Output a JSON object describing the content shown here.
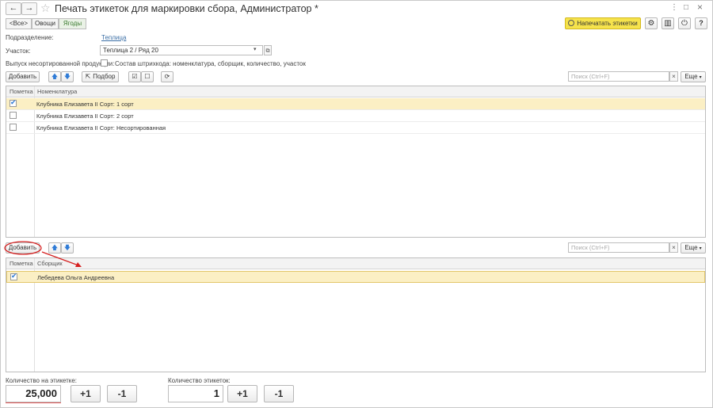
{
  "window": {
    "title": "Печать этикеток для маркировки сбора, Администратор *",
    "nav_back": "←",
    "nav_forward": "→",
    "star": "☆",
    "menu": "⋮",
    "maximize": "□",
    "close": "×"
  },
  "filters": {
    "all": "<Все>",
    "vegetables": "Овощи",
    "berries": "Ягоды"
  },
  "toolbar": {
    "print_label": "Напечатать этикетки",
    "gear": "⚙",
    "barcode": "▥",
    "power": "⏻",
    "help": "?"
  },
  "form": {
    "division_label": "Подразделение:",
    "division_value": "Теплица",
    "plot_label": "Участок:",
    "plot_value": "Теплица 2 / Ряд 20",
    "unsorted_label": "Выпуск несортированной продукции:",
    "barcode_composition": "Состав штрихкода: номенклатура, сборщик, количество, участок"
  },
  "products_toolbar": {
    "add": "Добавить",
    "pick": "Подбор",
    "search_placeholder": "Поиск (Ctrl+F)",
    "clear": "×",
    "more": "Еще"
  },
  "products_table": {
    "columns": [
      "Пометка",
      "Номенклатура"
    ],
    "rows": [
      {
        "checked": true,
        "name": "Клубника Елизавета II Сорт: 1 сорт"
      },
      {
        "checked": false,
        "name": "Клубника Елизавета II Сорт: 2 сорт"
      },
      {
        "checked": false,
        "name": "Клубника Елизавета II Сорт: Несортированная"
      }
    ]
  },
  "pickers_toolbar": {
    "add": "Добавить",
    "search_placeholder": "Поиск (Ctrl+F)",
    "clear": "×",
    "more": "Еще"
  },
  "pickers_table": {
    "columns": [
      "Пометка",
      "Сборщик"
    ],
    "rows": [
      {
        "checked": true,
        "name": "Лебедева Ольга Андреевна"
      }
    ]
  },
  "footer": {
    "qty_on_label_caption": "Количество на этикетке:",
    "qty_on_label_value": "25,000",
    "labels_count_caption": "Количество этикеток:",
    "labels_count_value": "1",
    "plus": "+1",
    "minus": "-1"
  },
  "colors": {
    "print_button": "#f6e34c",
    "selected_row": "#fbefc4",
    "annotation": "#d62020",
    "link": "#3a6ea5"
  }
}
